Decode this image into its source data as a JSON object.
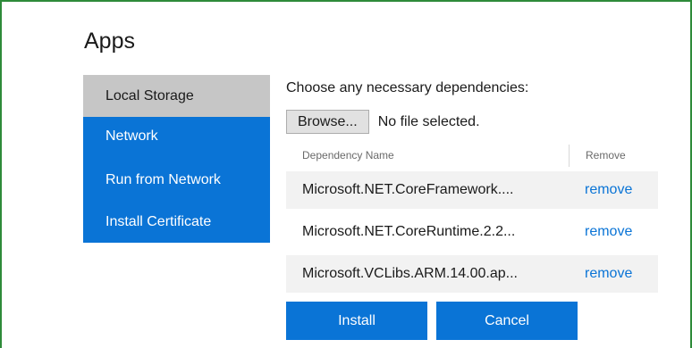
{
  "page": {
    "title": "Apps"
  },
  "nav": {
    "items": [
      {
        "label": "Local Storage"
      },
      {
        "label": "Network"
      },
      {
        "label": "Run from Network"
      },
      {
        "label": "Install Certificate"
      }
    ],
    "active_index": 0
  },
  "dependencies": {
    "prompt": "Choose any necessary dependencies:",
    "browse_label": "Browse...",
    "file_status": "No file selected.",
    "columns": {
      "name": "Dependency Name",
      "remove": "Remove"
    },
    "rows": [
      {
        "name": "Microsoft.NET.CoreFramework....",
        "action": "remove"
      },
      {
        "name": "Microsoft.NET.CoreRuntime.2.2...",
        "action": "remove"
      },
      {
        "name": "Microsoft.VCLibs.ARM.14.00.ap...",
        "action": "remove"
      }
    ]
  },
  "actions": {
    "install_label": "Install",
    "cancel_label": "Cancel"
  },
  "colors": {
    "accent": "#0a74d6",
    "nav_active": "#c6c6c6",
    "frame_border": "#2e8b3a",
    "row_shade": "#f2f2f2"
  }
}
